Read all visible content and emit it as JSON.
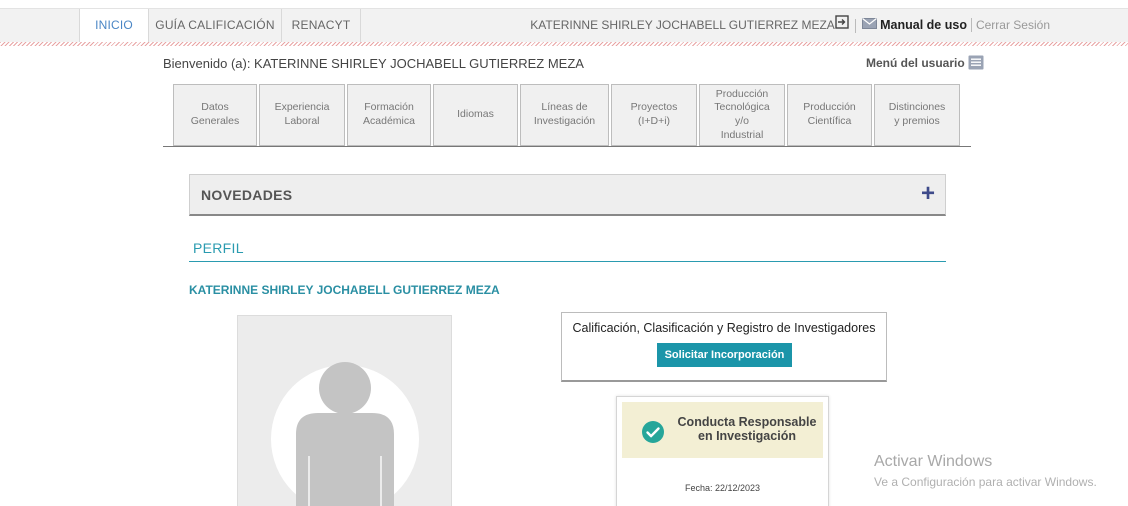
{
  "nav": {
    "tabs": [
      {
        "label": "INICIO"
      },
      {
        "label": "GUÍA CALIFICACIÓN"
      },
      {
        "label": "RENACYT"
      }
    ],
    "username": "KATERINNE SHIRLEY JOCHABELL GUTIERREZ MEZA",
    "manual_label": "Manual de uso",
    "logout_label": "Cerrar Sesión"
  },
  "welcome": {
    "text": "Bienvenido (a): KATERINNE SHIRLEY JOCHABELL GUTIERREZ MEZA",
    "user_menu_label": "Menú del usuario"
  },
  "section_tabs": [
    {
      "label": "Datos\nGenerales"
    },
    {
      "label": "Experiencia\nLaboral"
    },
    {
      "label": "Formación\nAcadémica"
    },
    {
      "label": "Idiomas"
    },
    {
      "label": "Líneas de\nInvestigación"
    },
    {
      "label": "Proyectos\n(I+D+i)"
    },
    {
      "label": "Producción\nTecnológica\ny/o\nIndustrial"
    },
    {
      "label": "Producción\nCientífica"
    },
    {
      "label": "Distinciones\ny premios"
    }
  ],
  "novedades": {
    "title": "NOVEDADES",
    "expand_symbol": "+"
  },
  "perfil": {
    "heading": "PERFIL",
    "full_name": "KATERINNE SHIRLEY JOCHABELL GUTIERREZ MEZA"
  },
  "calificacion_card": {
    "title": "Calificación, Clasificación y Registro de Investigadores",
    "button_label": "Solicitar Incorporación"
  },
  "conducta_badge": {
    "text": "Conducta Responsable\nen Investigación",
    "date": "Fecha: 22/12/2023"
  },
  "watermark": {
    "line1": "Activar Windows",
    "line2": "Ve a Configuración para activar Windows."
  },
  "colors": {
    "accent_teal": "#1b95a9",
    "active_tab_blue": "#4a86c5",
    "plus_navy": "#3e4a8a",
    "check_green": "#26a69a"
  }
}
